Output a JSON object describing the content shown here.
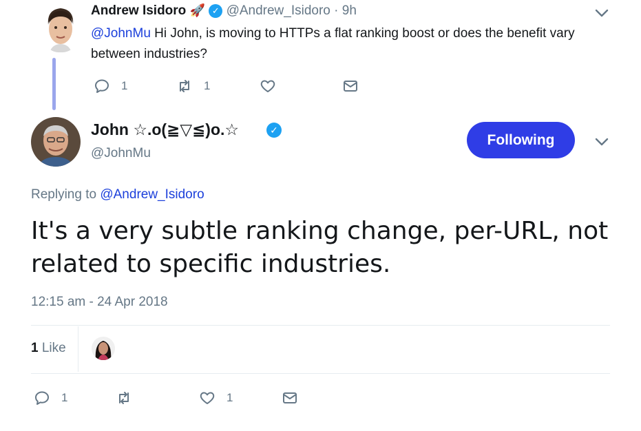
{
  "parent_tweet": {
    "display_name": "Andrew Isidoro",
    "emoji": "🚀",
    "handle": "@Andrew_Isidoro",
    "time": "· 9h",
    "mention": "@JohnMu",
    "text": " Hi John, is moving to HTTPs a flat ranking boost or does the benefit vary between industries?",
    "reply_count": "1",
    "retweet_count": "1"
  },
  "main_tweet": {
    "display_name": "John ☆.o(≧▽≦)o.☆",
    "handle": "@JohnMu",
    "follow_label": "Following",
    "replying_prefix": "Replying to",
    "replying_to": "@Andrew_Isidoro",
    "text": "It's a very subtle ranking change, per-URL, not related to specific industries.",
    "timestamp": "12:15 am - 24 Apr 2018",
    "likes_count": "1",
    "likes_label": "Like",
    "reply_count": "1",
    "like_count": "1"
  },
  "colors": {
    "link": "#1b3fdb",
    "follow_button": "#2f3de6",
    "thread_line": "#9aa6ec",
    "verified": "#1da1f2"
  },
  "icons": [
    "reply-icon",
    "retweet-icon",
    "heart-icon",
    "mail-icon",
    "chevron-down-icon",
    "verified-icon"
  ]
}
